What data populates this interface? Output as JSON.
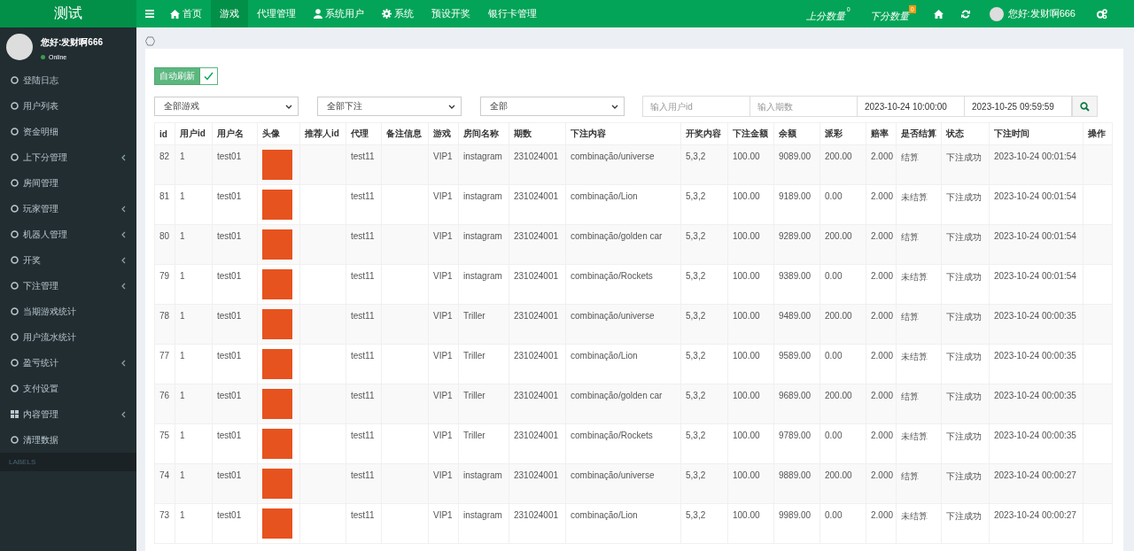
{
  "brand": "测试",
  "topnav": [
    {
      "label": "首页",
      "selected": false
    },
    {
      "label": "游戏",
      "selected": true
    },
    {
      "label": "代理管理",
      "selected": false
    },
    {
      "label": "系统用户",
      "selected": false
    },
    {
      "label": "系统",
      "selected": false
    },
    {
      "label": "预设开奖",
      "selected": false
    },
    {
      "label": "银行卡管理",
      "selected": false
    }
  ],
  "top_right": {
    "counters": [
      {
        "label": "上分数量",
        "badge": "0",
        "highlight": false
      },
      {
        "label": "下分数量",
        "badge": "0",
        "highlight": true
      }
    ],
    "user": "您好:发财啊666"
  },
  "sidebar": {
    "user": {
      "name": "您好:发财啊666",
      "status": "Online"
    },
    "items": [
      {
        "label": "登陆日志",
        "kind": "circle",
        "has_submenu": false
      },
      {
        "label": "用户列表",
        "kind": "circle",
        "has_submenu": false
      },
      {
        "label": "资金明细",
        "kind": "circle",
        "has_submenu": false
      },
      {
        "label": "上下分管理",
        "kind": "circle",
        "has_submenu": true
      },
      {
        "label": "房间管理",
        "kind": "circle",
        "has_submenu": false
      },
      {
        "label": "玩家管理",
        "kind": "circle",
        "has_submenu": true
      },
      {
        "label": "机器人管理",
        "kind": "circle",
        "has_submenu": true
      },
      {
        "label": "开奖",
        "kind": "circle",
        "has_submenu": true
      },
      {
        "label": "下注管理",
        "kind": "circle",
        "has_submenu": true
      },
      {
        "label": "当期游戏统计",
        "kind": "circle",
        "has_submenu": false
      },
      {
        "label": "用户流水统计",
        "kind": "circle",
        "has_submenu": false
      },
      {
        "label": "盈亏统计",
        "kind": "circle",
        "has_submenu": true
      },
      {
        "label": "支付设置",
        "kind": "circle",
        "has_submenu": false
      },
      {
        "label": "内容管理",
        "kind": "grid",
        "has_submenu": true
      },
      {
        "label": "清理数据",
        "kind": "circle",
        "has_submenu": false
      }
    ],
    "section_header": "LABELS"
  },
  "auto_refresh": {
    "label": "自动刷新",
    "checked": true
  },
  "filters": {
    "selects": [
      "全部游戏",
      "全部下注",
      "全部"
    ],
    "user_id": {
      "placeholder": "输入用户id"
    },
    "period": {
      "placeholder": "输入期数"
    },
    "start": "2023-10-24 10:00:00",
    "end": "2023-10-25 09:59:59"
  },
  "table": {
    "columns": [
      "id",
      "用户id",
      "用户名",
      "头像",
      "推荐人id",
      "代理",
      "备注信息",
      "游戏",
      "房间名称",
      "期数",
      "下注内容",
      "开奖内容",
      "下注金额",
      "余额",
      "派彩",
      "赔率",
      "是否结算",
      "状态",
      "下注时间",
      "操作"
    ],
    "rows": [
      [
        "82",
        "1",
        "test01",
        "",
        "",
        "test11",
        "",
        "VIP1",
        "instagram",
        "231024001",
        "combinação/universe",
        "5,3,2",
        "100.00",
        "9089.00",
        "200.00",
        "2.000",
        "结算",
        "下注成功",
        "2023-10-24 00:01:54",
        ""
      ],
      [
        "81",
        "1",
        "test01",
        "",
        "",
        "test11",
        "",
        "VIP1",
        "instagram",
        "231024001",
        "combinação/Lion",
        "5,3,2",
        "100.00",
        "9189.00",
        "0.00",
        "2.000",
        "未结算",
        "下注成功",
        "2023-10-24 00:01:54",
        ""
      ],
      [
        "80",
        "1",
        "test01",
        "",
        "",
        "test11",
        "",
        "VIP1",
        "instagram",
        "231024001",
        "combinação/golden car",
        "5,3,2",
        "100.00",
        "9289.00",
        "200.00",
        "2.000",
        "结算",
        "下注成功",
        "2023-10-24 00:01:54",
        ""
      ],
      [
        "79",
        "1",
        "test01",
        "",
        "",
        "test11",
        "",
        "VIP1",
        "instagram",
        "231024001",
        "combinação/Rockets",
        "5,3,2",
        "100.00",
        "9389.00",
        "0.00",
        "2.000",
        "未结算",
        "下注成功",
        "2023-10-24 00:01:54",
        ""
      ],
      [
        "78",
        "1",
        "test01",
        "",
        "",
        "test11",
        "",
        "VIP1",
        "Triller",
        "231024001",
        "combinação/universe",
        "5,3,2",
        "100.00",
        "9489.00",
        "200.00",
        "2.000",
        "结算",
        "下注成功",
        "2023-10-24 00:00:35",
        ""
      ],
      [
        "77",
        "1",
        "test01",
        "",
        "",
        "test11",
        "",
        "VIP1",
        "Triller",
        "231024001",
        "combinação/Lion",
        "5,3,2",
        "100.00",
        "9589.00",
        "0.00",
        "2.000",
        "未结算",
        "下注成功",
        "2023-10-24 00:00:35",
        ""
      ],
      [
        "76",
        "1",
        "test01",
        "",
        "",
        "test11",
        "",
        "VIP1",
        "Triller",
        "231024001",
        "combinação/golden car",
        "5,3,2",
        "100.00",
        "9689.00",
        "200.00",
        "2.000",
        "结算",
        "下注成功",
        "2023-10-24 00:00:35",
        ""
      ],
      [
        "75",
        "1",
        "test01",
        "",
        "",
        "test11",
        "",
        "VIP1",
        "Triller",
        "231024001",
        "combinação/Rockets",
        "5,3,2",
        "100.00",
        "9789.00",
        "0.00",
        "2.000",
        "未结算",
        "下注成功",
        "2023-10-24 00:00:35",
        ""
      ],
      [
        "74",
        "1",
        "test01",
        "",
        "",
        "test11",
        "",
        "VIP1",
        "instagram",
        "231024001",
        "combinação/universe",
        "5,3,2",
        "100.00",
        "9889.00",
        "200.00",
        "2.000",
        "结算",
        "下注成功",
        "2023-10-24 00:00:27",
        ""
      ],
      [
        "73",
        "1",
        "test01",
        "",
        "",
        "test11",
        "",
        "VIP1",
        "instagram",
        "231024001",
        "combinação/Lion",
        "5,3,2",
        "100.00",
        "9989.00",
        "0.00",
        "2.000",
        "未结算",
        "下注成功",
        "2023-10-24 00:00:27",
        ""
      ]
    ]
  }
}
